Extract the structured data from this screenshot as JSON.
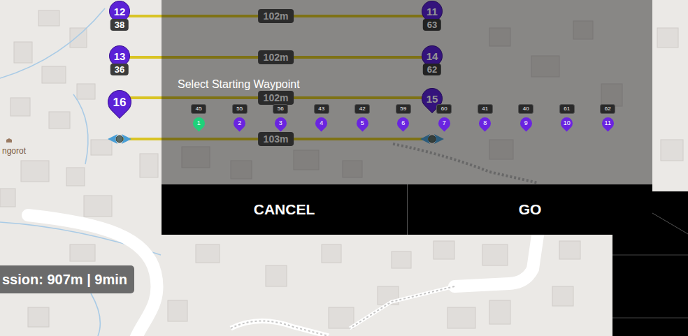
{
  "map": {
    "place_label": "ngorot",
    "mission_summary": "ssion: 907m | 9min"
  },
  "route": {
    "legs": [
      {
        "distance": "102m"
      },
      {
        "distance": "102m"
      },
      {
        "distance": "102m"
      },
      {
        "distance": "103m"
      }
    ],
    "waypoints": [
      {
        "number": "12",
        "badge": "38"
      },
      {
        "number": "13",
        "badge": "36"
      },
      {
        "number": "16"
      },
      {
        "number": "11",
        "badge": "63"
      },
      {
        "number": "14",
        "badge": "62"
      },
      {
        "number": "15"
      }
    ]
  },
  "dialog": {
    "title": "Select Starting Waypoint",
    "waypoints": [
      {
        "number": "1",
        "badge": "45",
        "selected": true
      },
      {
        "number": "2",
        "badge": "55",
        "selected": false
      },
      {
        "number": "3",
        "badge": "56",
        "selected": false
      },
      {
        "number": "4",
        "badge": "43",
        "selected": false
      },
      {
        "number": "5",
        "badge": "42",
        "selected": false
      },
      {
        "number": "6",
        "badge": "59",
        "selected": false
      },
      {
        "number": "7",
        "badge": "60",
        "selected": false
      },
      {
        "number": "8",
        "badge": "41",
        "selected": false
      },
      {
        "number": "9",
        "badge": "40",
        "selected": false
      },
      {
        "number": "10",
        "badge": "61",
        "selected": false
      },
      {
        "number": "11",
        "badge": "62",
        "selected": false
      }
    ],
    "buttons": [
      "CANCEL",
      "GO"
    ]
  }
}
